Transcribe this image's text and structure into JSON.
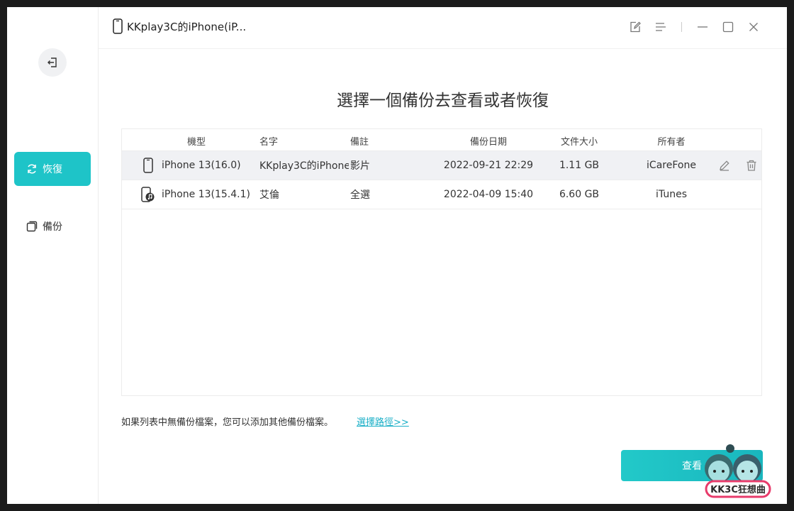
{
  "window": {
    "device_title": "KKplay3C的iPhone(iP..."
  },
  "sidebar": {
    "items": [
      {
        "label": "恢復",
        "icon": "refresh-icon",
        "active": true
      },
      {
        "label": "備份",
        "icon": "copy-icon",
        "active": false
      }
    ]
  },
  "main": {
    "heading": "選擇一個備份去查看或者恢復",
    "table": {
      "headers": {
        "model": "機型",
        "name": "名字",
        "note": "備註",
        "date": "備份日期",
        "size": "文件大小",
        "owner": "所有者"
      },
      "rows": [
        {
          "icon": "iphone-icon",
          "model": "iPhone 13(16.0)",
          "name": "KKplay3C的iPhone",
          "note": "影片",
          "date": "2022-09-21 22:29",
          "size": "1.11 GB",
          "owner": "iCareFone",
          "selected": true
        },
        {
          "icon": "itunes-device-icon",
          "model": "iPhone 13(15.4.1)",
          "name": "艾倫",
          "note": "全選",
          "date": "2022-04-09 15:40",
          "size": "6.60 GB",
          "owner": "iTunes",
          "selected": false
        }
      ]
    },
    "hint_text": "如果列表中無備份檔案，您可以添加其他備份檔案。",
    "select_path_link": "選擇路徑>>",
    "view_button": "查看",
    "watermark_text": "KK3C狂想曲"
  },
  "colors": {
    "accent": "#1ec4c8",
    "link": "#1aafc7"
  }
}
